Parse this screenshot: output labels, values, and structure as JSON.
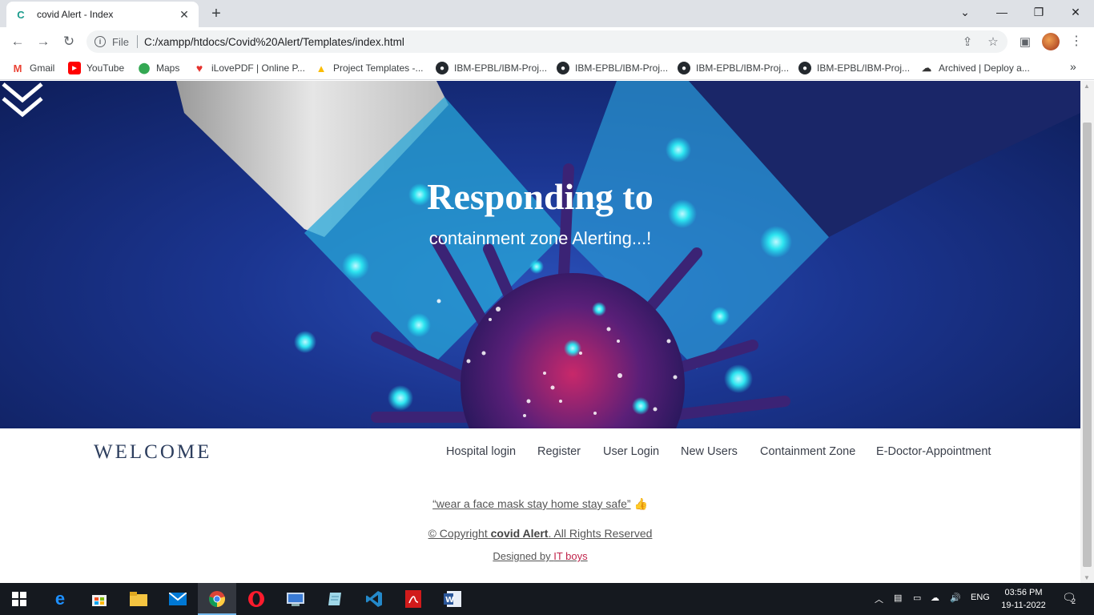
{
  "browser": {
    "tab_title": "covid Alert - Index",
    "tab_favicon": "C",
    "url_scheme": "File",
    "url": "C:/xampp/htdocs/Covid%20Alert/Templates/index.html"
  },
  "bookmarks": [
    {
      "label": "Gmail",
      "icon": "gmail-icon",
      "color": "#ea4335"
    },
    {
      "label": "YouTube",
      "icon": "youtube-icon",
      "color": "#ff0000"
    },
    {
      "label": "Maps",
      "icon": "maps-icon",
      "color": "#34a853"
    },
    {
      "label": "iLovePDF | Online P...",
      "icon": "ilovepdf-icon",
      "color": "#e5322d"
    },
    {
      "label": "Project Templates -...",
      "icon": "drive-icon",
      "color": "#fbbc04"
    },
    {
      "label": "IBM-EPBL/IBM-Proj...",
      "icon": "github-icon",
      "color": "#24292e"
    },
    {
      "label": "IBM-EPBL/IBM-Proj...",
      "icon": "github-icon",
      "color": "#24292e"
    },
    {
      "label": "IBM-EPBL/IBM-Proj...",
      "icon": "github-icon",
      "color": "#24292e"
    },
    {
      "label": "IBM-EPBL/IBM-Proj...",
      "icon": "github-icon",
      "color": "#24292e"
    },
    {
      "label": "Archived | Deploy a...",
      "icon": "deploy-icon",
      "color": "#333333"
    }
  ],
  "hero": {
    "title": "Responding to",
    "subtitle": "containment zone Alerting...!"
  },
  "nav": {
    "brand": "WELCOME",
    "links": [
      "Hospital login",
      "Register",
      "User Login",
      "New Users",
      "Containment Zone",
      "E-Doctor-Appointment"
    ]
  },
  "footer": {
    "quote": "“wear a face mask stay home stay safe”",
    "copyright_prefix": "© Copyright ",
    "copyright_brand": "covid Alert",
    "copyright_suffix": ". All Rights Reserved",
    "designed_prefix": "Designed by ",
    "designed_by": "IT boys"
  },
  "taskbar": {
    "language": "ENG",
    "time": "03:56 PM",
    "date": "19-11-2022",
    "notifications": "2"
  }
}
